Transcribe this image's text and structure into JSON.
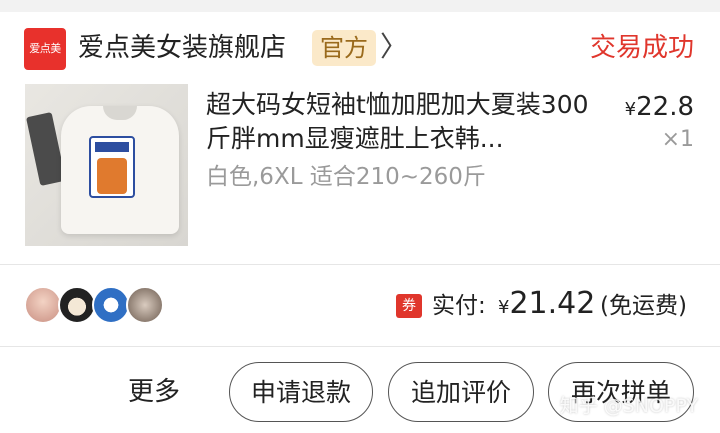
{
  "store": {
    "logo_text": "爱点美",
    "name": "爱点美女装旗舰店",
    "badge": "官方",
    "arrow": "〉",
    "status": "交易成功"
  },
  "product": {
    "title": "超大码女短袖t恤加肥加大夏装300斤胖mm显瘦遮肚上衣韩...",
    "sku": "白色,6XL 适合210~260斤",
    "price_currency": "¥",
    "price": "22.8",
    "quantity": "×1"
  },
  "summary": {
    "coupon_icon": "券",
    "paid_label": "实付:",
    "paid_currency": "¥",
    "paid_amount": "21.42",
    "paid_note": "(免运费)"
  },
  "actions": {
    "more": "更多",
    "refund": "申请退款",
    "review": "追加评价",
    "rebuy": "再次拼单"
  },
  "watermark": "知乎 @SNOPPY",
  "colors": {
    "accent": "#e0362c",
    "badge_bg": "#fbe9c9",
    "badge_text": "#9a6a1c"
  }
}
